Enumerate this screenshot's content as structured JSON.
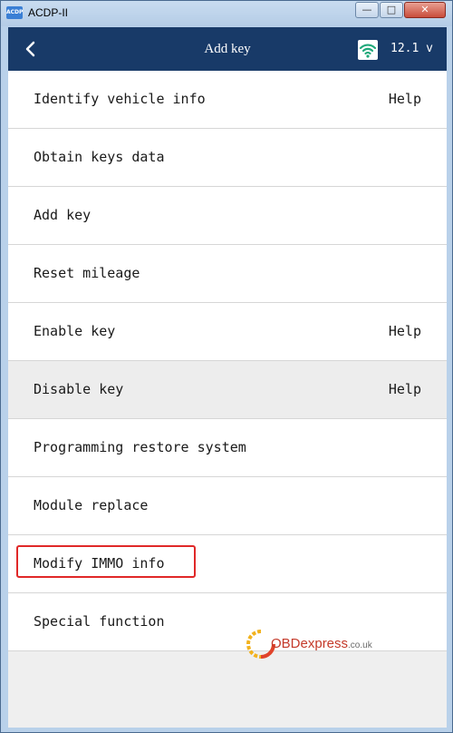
{
  "window": {
    "app_icon_text": "ACDP",
    "title": "ACDP-II",
    "minimize": "—",
    "maximize": "□",
    "close": "✕"
  },
  "header": {
    "back_icon": "chevron-left-icon",
    "title": "Add key",
    "wifi_icon": "wifi-icon",
    "voltage": "12.1 v"
  },
  "menu": {
    "items": [
      {
        "label": "Identify vehicle info",
        "help": "Help"
      },
      {
        "label": "Obtain keys data",
        "help": ""
      },
      {
        "label": "Add key",
        "help": ""
      },
      {
        "label": "Reset mileage",
        "help": ""
      },
      {
        "label": "Enable key",
        "help": "Help"
      },
      {
        "label": "Disable key",
        "help": "Help"
      },
      {
        "label": "Programming restore system",
        "help": ""
      },
      {
        "label": "Module replace",
        "help": ""
      },
      {
        "label": "Modify IMMO info",
        "help": ""
      },
      {
        "label": "Special function",
        "help": ""
      }
    ]
  },
  "watermark": {
    "brand": "OBDexpress",
    "tld": ".co.uk"
  },
  "colors": {
    "header_bg": "#183a68",
    "highlight": "#e02828",
    "wifi": "#1fa87a"
  }
}
